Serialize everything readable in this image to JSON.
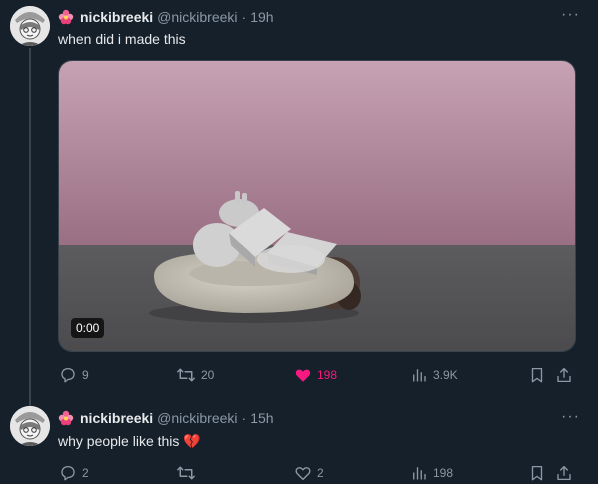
{
  "tweets": [
    {
      "name": "nickibreeki",
      "handle": "@nickibreeki",
      "time": "19h",
      "text": "when did i made this",
      "media": {
        "duration": "0:00"
      },
      "actions": {
        "replies": "9",
        "reposts": "20",
        "likes": "198",
        "views": "3.9K"
      },
      "liked": true
    },
    {
      "name": "nickibreeki",
      "handle": "@nickibreeki",
      "time": "15h",
      "text": "why people like this 💔",
      "actions": {
        "replies": "2",
        "reposts": "",
        "likes": "2",
        "views": "198"
      },
      "liked": false
    }
  ],
  "colors": {
    "background": "#15202b",
    "muted": "#8b98a5",
    "like": "#f91880"
  },
  "icons": [
    "more-icon",
    "reply-icon",
    "repost-icon",
    "like-icon",
    "views-icon",
    "bookmark-icon",
    "share-icon",
    "flower-emoji"
  ]
}
